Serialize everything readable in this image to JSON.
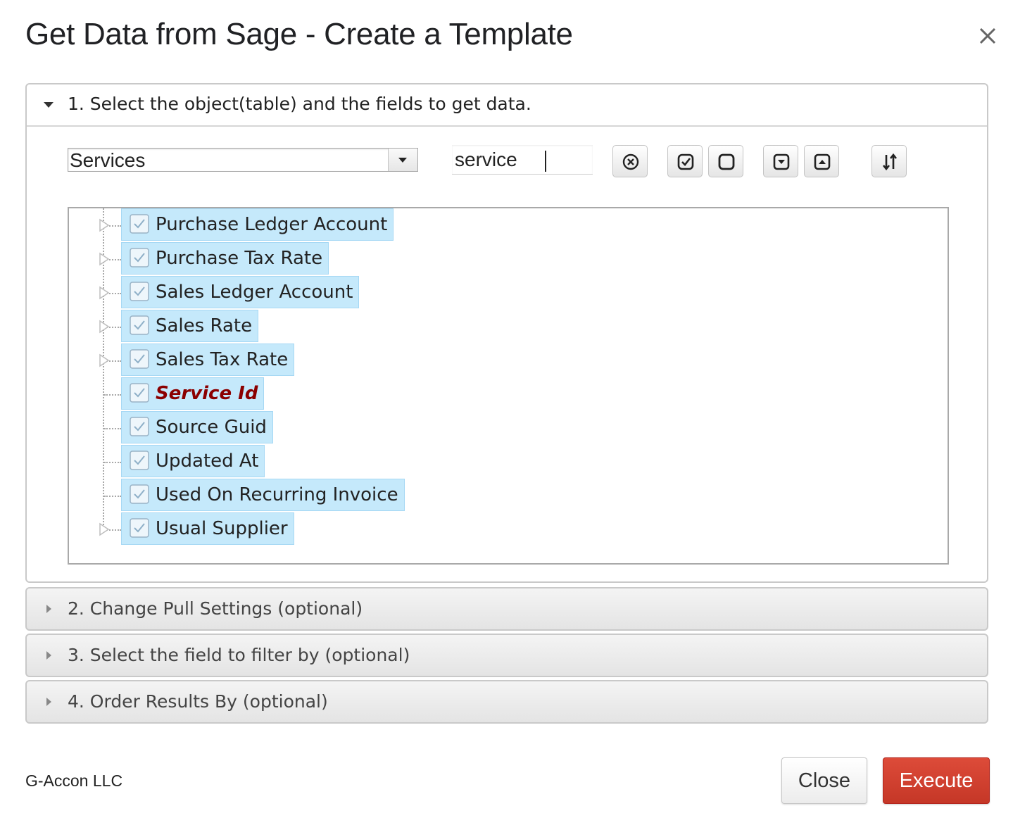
{
  "dialog": {
    "title": "Get Data from Sage - Create a Template",
    "close_icon": "close-icon"
  },
  "sections": [
    {
      "label": "1. Select the object(table) and the fields to get data.",
      "expanded": true
    },
    {
      "label": "2. Change Pull Settings (optional)",
      "expanded": false
    },
    {
      "label": "3. Select the field to filter by (optional)",
      "expanded": false
    },
    {
      "label": "4. Order Results By (optional)",
      "expanded": false
    }
  ],
  "object_select": {
    "selected": "Services"
  },
  "search": {
    "value": "service"
  },
  "toolbar": {
    "icons": [
      "clear-search-icon",
      "select-all-icon",
      "deselect-all-icon",
      "expand-all-icon",
      "collapse-all-icon",
      "sort-icon"
    ]
  },
  "tree": {
    "items": [
      {
        "label": "Purchase Ledger Account",
        "checked": true,
        "expandable": true,
        "key": false
      },
      {
        "label": "Purchase Tax Rate",
        "checked": true,
        "expandable": true,
        "key": false
      },
      {
        "label": "Sales Ledger Account",
        "checked": true,
        "expandable": true,
        "key": false
      },
      {
        "label": "Sales Rate",
        "checked": true,
        "expandable": true,
        "key": false
      },
      {
        "label": "Sales Tax Rate",
        "checked": true,
        "expandable": true,
        "key": false
      },
      {
        "label": "Service Id",
        "checked": true,
        "expandable": false,
        "key": true
      },
      {
        "label": "Source Guid",
        "checked": true,
        "expandable": false,
        "key": false
      },
      {
        "label": "Updated At",
        "checked": true,
        "expandable": false,
        "key": false
      },
      {
        "label": "Used On Recurring Invoice",
        "checked": true,
        "expandable": false,
        "key": false
      },
      {
        "label": "Usual Supplier",
        "checked": true,
        "expandable": true,
        "key": false
      }
    ]
  },
  "footer": {
    "brand": "G-Accon LLC",
    "close_label": "Close",
    "execute_label": "Execute"
  },
  "colors": {
    "node_bg": "#c5e9fb",
    "key_field": "#8b0000",
    "execute_bg": "#d14836"
  }
}
